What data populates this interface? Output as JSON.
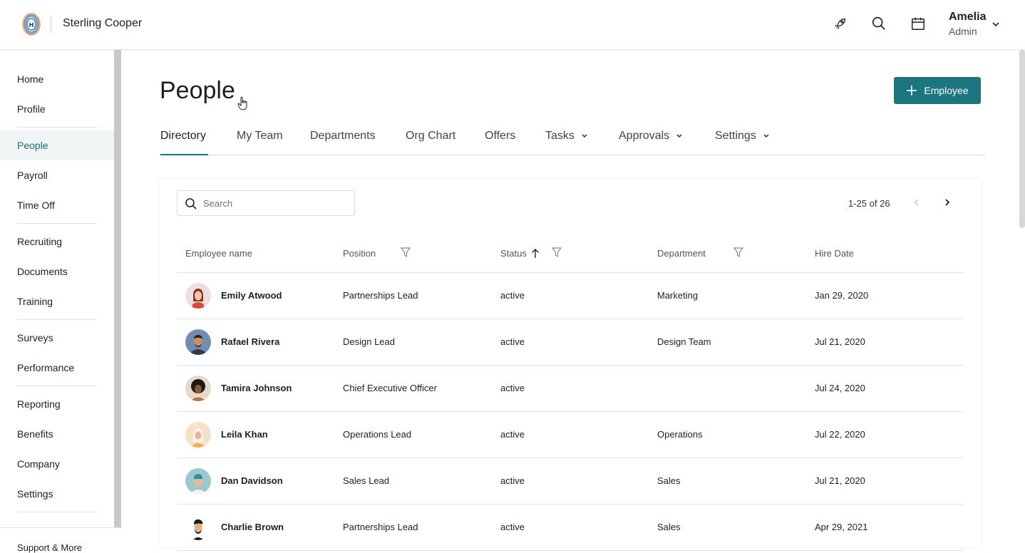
{
  "header": {
    "company_name": "Sterling Cooper",
    "user_name": "Amelia",
    "user_role": "Admin",
    "icons": [
      "rocket-icon",
      "search-icon",
      "calendar-icon",
      "chevron-down-icon"
    ]
  },
  "sidebar": {
    "items": [
      {
        "label": "Home"
      },
      {
        "label": "Profile"
      },
      {
        "label": "People",
        "active": true
      },
      {
        "label": "Payroll"
      },
      {
        "label": "Time Off"
      },
      {
        "label": "Recruiting"
      },
      {
        "label": "Documents"
      },
      {
        "label": "Training"
      },
      {
        "label": "Surveys"
      },
      {
        "label": "Performance"
      },
      {
        "label": "Reporting"
      },
      {
        "label": "Benefits"
      },
      {
        "label": "Company"
      },
      {
        "label": "Settings"
      }
    ],
    "footer_label": "Support & More"
  },
  "main": {
    "title": "People",
    "add_button_label": "Employee",
    "tabs": [
      {
        "label": "Directory",
        "active": true
      },
      {
        "label": "My Team"
      },
      {
        "label": "Departments"
      },
      {
        "label": "Org Chart"
      },
      {
        "label": "Offers"
      },
      {
        "label": "Tasks",
        "dropdown": true
      },
      {
        "label": "Approvals",
        "dropdown": true
      },
      {
        "label": "Settings",
        "dropdown": true
      }
    ]
  },
  "table": {
    "search_placeholder": "Search",
    "pagination": "1-25 of 26",
    "columns": [
      "Employee name",
      "Position",
      "Status",
      "Department",
      "Hire Date"
    ],
    "rows": [
      {
        "name": "Emily Atwood",
        "position": "Partnerships Lead",
        "status": "active",
        "department": "Marketing",
        "hire_date": "Jan 29, 2020"
      },
      {
        "name": "Rafael Rivera",
        "position": "Design Lead",
        "status": "active",
        "department": "Design Team",
        "hire_date": "Jul 21, 2020"
      },
      {
        "name": "Tamira Johnson",
        "position": "Chief Executive Officer",
        "status": "active",
        "department": "",
        "hire_date": "Jul 24, 2020"
      },
      {
        "name": "Leila Khan",
        "position": "Operations Lead",
        "status": "active",
        "department": "Operations",
        "hire_date": "Jul 22, 2020"
      },
      {
        "name": "Dan Davidson",
        "position": "Sales Lead",
        "status": "active",
        "department": "Sales",
        "hire_date": "Jul 21, 2020"
      },
      {
        "name": "Charlie Brown",
        "position": "Partnerships Lead",
        "status": "active",
        "department": "Sales",
        "hire_date": "Apr 29, 2021"
      }
    ]
  },
  "colors": {
    "accent": "#1b7680",
    "active_nav_bg": "#f0f5f5",
    "active_nav_text": "#1a6f75"
  }
}
